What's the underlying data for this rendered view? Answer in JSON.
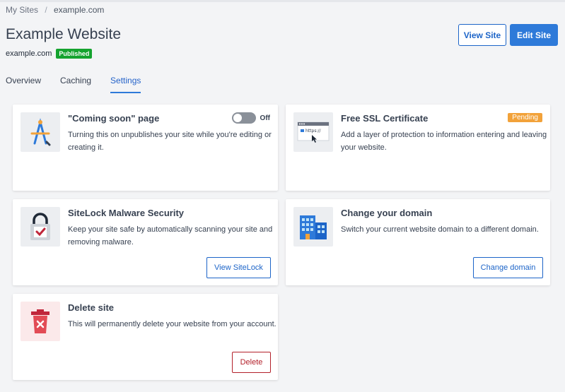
{
  "breadcrumb": {
    "root": "My Sites",
    "separator": "/",
    "current": "example.com"
  },
  "site": {
    "title": "Example Website",
    "domain": "example.com",
    "status_badge": "Published"
  },
  "header_buttons": {
    "view_site": "View Site",
    "edit_site": "Edit Site"
  },
  "tabs": [
    {
      "label": "Overview",
      "active": false
    },
    {
      "label": "Caching",
      "active": false
    },
    {
      "label": "Settings",
      "active": true
    }
  ],
  "cards": {
    "coming_soon": {
      "title": "\"Coming soon\" page",
      "description_line1": "Turning this on unpublishes your site while you're editing or",
      "description_line2": "creating it.",
      "toggle_label": "Off",
      "toggle_on": false,
      "icon": "drafting-tools-icon"
    },
    "ssl": {
      "title": "Free SSL Certificate",
      "description_line1": "Add a layer of protection to information entering and leaving",
      "description_line2": "your website.",
      "badge": "Pending",
      "icon_text": "https://",
      "icon": "browser-https-icon"
    },
    "sitelock": {
      "title": "SiteLock Malware Security",
      "description_line1": "Keep your site safe by automatically scanning your site and",
      "description_line2": "removing malware.",
      "button": "View SiteLock",
      "icon": "padlock-check-icon"
    },
    "domain": {
      "title": "Change your domain",
      "description_line1": "Switch your current website domain to a different domain.",
      "button": "Change domain",
      "icon": "building-icon"
    },
    "delete": {
      "title": "Delete site",
      "description_line1": "This will permanently delete your website from your account.",
      "button": "Delete",
      "icon": "trash-icon"
    }
  },
  "colors": {
    "primary": "#2e7ad9",
    "published": "#15a32f",
    "pending": "#f2a23a",
    "danger": "#b3202a"
  }
}
